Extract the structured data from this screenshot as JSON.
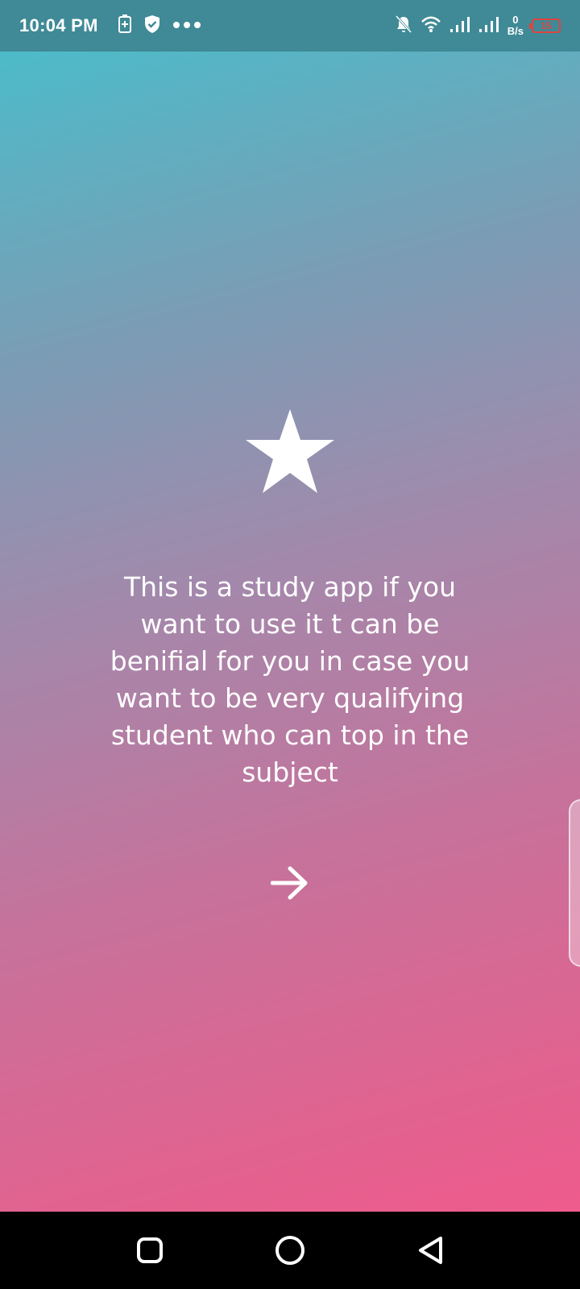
{
  "status_bar": {
    "time": "10:04 PM",
    "left_icons": [
      "battery-saver-icon",
      "shield-icon",
      "more-dots-icon"
    ],
    "right_icons": [
      "bell-off-icon",
      "wifi-icon",
      "signal-icon",
      "signal-icon"
    ],
    "net_speed_value": "0",
    "net_speed_unit": "B/s",
    "battery_level": "15",
    "battery_color": "#e0433f"
  },
  "onboarding": {
    "icon": "star-icon",
    "text": "This is a study app if you want to use it t can be benifial for you in case you want to be very qualifying student who can top in the subject",
    "next_icon": "arrow-right-icon"
  },
  "background": {
    "gradient_start": "#45c0cc",
    "gradient_end": "#f5578b"
  },
  "nav_bar": {
    "buttons": [
      "recents-square-icon",
      "home-circle-icon",
      "back-triangle-icon"
    ]
  }
}
